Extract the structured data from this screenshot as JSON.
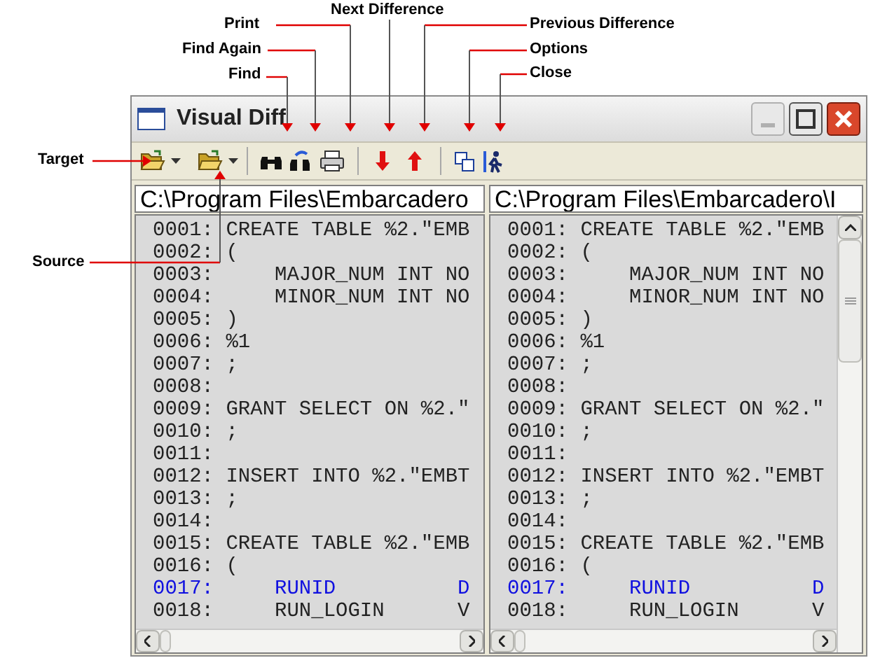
{
  "annotations": [
    {
      "label": "Next Difference"
    },
    {
      "label": "Print"
    },
    {
      "label": "Previous Difference"
    },
    {
      "label": "Find Again"
    },
    {
      "label": "Options"
    },
    {
      "label": "Find"
    },
    {
      "label": "Close"
    },
    {
      "label": "Target"
    },
    {
      "label": "Source"
    }
  ],
  "window": {
    "title": "Visual Diff"
  },
  "panes": [
    {
      "path": "C:\\Program Files\\Embarcadero",
      "lines": [
        {
          "number": "0001:",
          "code": "CREATE TABLE %2.\"EMB",
          "changed": false
        },
        {
          "number": "0002:",
          "code": "(",
          "changed": false
        },
        {
          "number": "0003:",
          "code": "    MAJOR_NUM INT NO",
          "changed": false
        },
        {
          "number": "0004:",
          "code": "    MINOR_NUM INT NO",
          "changed": false
        },
        {
          "number": "0005:",
          "code": ")",
          "changed": false
        },
        {
          "number": "0006:",
          "code": "%1",
          "changed": false
        },
        {
          "number": "0007:",
          "code": ";",
          "changed": false
        },
        {
          "number": "0008:",
          "changed": false
        },
        {
          "number": "0009:",
          "code": "GRANT SELECT ON %2.\"",
          "changed": false
        },
        {
          "number": "0010:",
          "code": ";",
          "changed": false
        },
        {
          "number": "0011:",
          "changed": false
        },
        {
          "number": "0012:",
          "code": "INSERT INTO %2.\"EMBT",
          "changed": false
        },
        {
          "number": "0013:",
          "code": ";",
          "changed": false
        },
        {
          "number": "0014:",
          "changed": false
        },
        {
          "number": "0015:",
          "code": "CREATE TABLE %2.\"EMB",
          "changed": false
        },
        {
          "number": "0016:",
          "code": "(",
          "changed": false
        },
        {
          "number": "0017:",
          "code": "    RUNID          D",
          "changed": true
        },
        {
          "number": "0018:",
          "code": "    RUN_LOGIN      V",
          "changed": false
        }
      ]
    },
    {
      "path": "C:\\Program Files\\Embarcadero\\I",
      "lines": [
        {
          "number": "0001:",
          "code": "CREATE TABLE %2.\"EMB",
          "changed": false
        },
        {
          "number": "0002:",
          "code": "(",
          "changed": false
        },
        {
          "number": "0003:",
          "code": "    MAJOR_NUM INT NO",
          "changed": false
        },
        {
          "number": "0004:",
          "code": "    MINOR_NUM INT NO",
          "changed": false
        },
        {
          "number": "0005:",
          "code": ")",
          "changed": false
        },
        {
          "number": "0006:",
          "code": "%1",
          "changed": false
        },
        {
          "number": "0007:",
          "code": ";",
          "changed": false
        },
        {
          "number": "0008:",
          "changed": false
        },
        {
          "number": "0009:",
          "code": "GRANT SELECT ON %2.\"",
          "changed": false
        },
        {
          "number": "0010:",
          "code": ";",
          "changed": false
        },
        {
          "number": "0011:",
          "changed": false
        },
        {
          "number": "0012:",
          "code": "INSERT INTO %2.\"EMBT",
          "changed": false
        },
        {
          "number": "0013:",
          "code": ";",
          "changed": false
        },
        {
          "number": "0014:",
          "changed": false
        },
        {
          "number": "0015:",
          "code": "CREATE TABLE %2.\"EMB",
          "changed": false
        },
        {
          "number": "0016:",
          "code": "(",
          "changed": false
        },
        {
          "number": "0017:",
          "code": "    RUNID          D",
          "changed": true
        },
        {
          "number": "0018:",
          "code": "    RUN_LOGIN      V",
          "changed": false
        }
      ]
    }
  ]
}
